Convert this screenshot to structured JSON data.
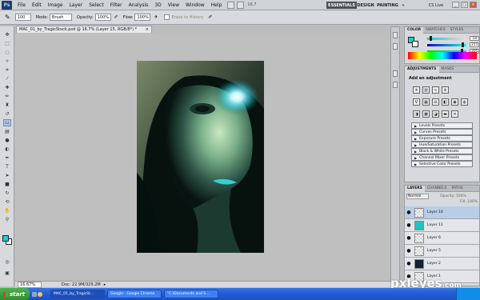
{
  "menubar": {
    "logo": "Ps",
    "items": [
      "File",
      "Edit",
      "Image",
      "Layer",
      "Select",
      "Filter",
      "Analysis",
      "3D",
      "View",
      "Window",
      "Help"
    ],
    "zoom": "16.7",
    "workspaces": {
      "essentials": "ESSENTIALS",
      "design": "DESIGN",
      "painting": "PAINTING"
    },
    "cs_live": "CS Live"
  },
  "options": {
    "brush_size": "100",
    "mode_label": "Mode:",
    "mode_value": "Brush",
    "opacity_label": "Opacity:",
    "opacity_value": "100%",
    "flow_label": "Flow:",
    "flow_value": "100%",
    "erase_history": "Erase to History"
  },
  "document": {
    "tab_title": "MAC_01_by_TragicStock.psd @ 16.7% (Layer 15, RGB/8*) *",
    "close": "×",
    "status_zoom": "16.67%",
    "status_doc": "Doc: 22.9M/329.2M"
  },
  "color_panel": {
    "tabs": [
      "COLOR",
      "SWATCHES",
      "STYLES"
    ],
    "values": {
      "r": "18",
      "g": "211",
      "b": "205"
    },
    "fg_color": "#12d3d9"
  },
  "adjustments": {
    "tabs": [
      "ADJUSTMENTS",
      "MASKS"
    ],
    "heading": "Add an adjustment",
    "presets": [
      "Levels Presets",
      "Curves Presets",
      "Exposure Presets",
      "Hue/Saturation Presets",
      "Black & White Presets",
      "Channel Mixer Presets",
      "Selective Color Presets"
    ]
  },
  "layers": {
    "tabs": [
      "LAYERS",
      "CHANNELS",
      "PATHS"
    ],
    "blend_mode": "Normal",
    "opacity": "Opacity: 100%",
    "fill": "Fill: 100%",
    "items": [
      "Layer 10",
      "Layer 11",
      "Layer 6",
      "Layer 5",
      "Layer 2",
      "Layer 1"
    ]
  },
  "taskbar": {
    "start": "start",
    "tasks": [
      "MAC_01_by_TragicSt...",
      "Google - Google Chrome",
      "\"C:\\Documents and S..."
    ]
  },
  "watermark": {
    "text": "pxleyes",
    "suffix": ".com"
  }
}
